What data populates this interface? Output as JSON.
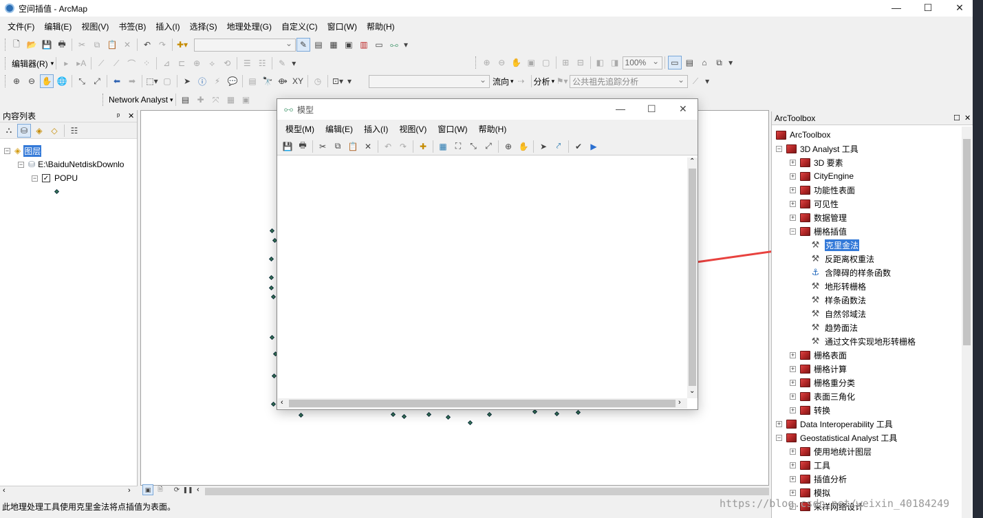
{
  "window": {
    "title": "空间插值 - ArcMap"
  },
  "menu": [
    "文件(F)",
    "编辑(E)",
    "视图(V)",
    "书签(B)",
    "插入(I)",
    "选择(S)",
    "地理处理(G)",
    "自定义(C)",
    "窗口(W)",
    "帮助(H)"
  ],
  "toolbars": {
    "editor_label": "编辑器(R)",
    "zoom_value": "100%",
    "flow_label": "流向",
    "analysis_label": "分析",
    "trace_combo": "公共祖先追踪分析",
    "network_analyst_label": "Network Analyst"
  },
  "toc": {
    "title": "内容列表",
    "pin": "ᵖ",
    "close": "✕",
    "layers_root": "图层",
    "data_source": "E:\\BaiduNetdiskDownlo",
    "layer": "POPU"
  },
  "model_window": {
    "title": "模型",
    "menu": [
      "模型(M)",
      "编辑(E)",
      "插入(I)",
      "视图(V)",
      "窗口(W)",
      "帮助(H)"
    ]
  },
  "toolbox": {
    "title": "ArcToolbox",
    "root": "ArcToolbox",
    "items": [
      {
        "label": "3D Analyst 工具",
        "level": 1,
        "expander": "⊟",
        "icon": "box"
      },
      {
        "label": "3D 要素",
        "level": 2,
        "expander": "⊞",
        "icon": "box"
      },
      {
        "label": "CityEngine",
        "level": 2,
        "expander": "⊞",
        "icon": "box"
      },
      {
        "label": "功能性表面",
        "level": 2,
        "expander": "⊞",
        "icon": "box"
      },
      {
        "label": "可见性",
        "level": 2,
        "expander": "⊞",
        "icon": "box"
      },
      {
        "label": "数据管理",
        "level": 2,
        "expander": "⊞",
        "icon": "box"
      },
      {
        "label": "栅格插值",
        "level": 2,
        "expander": "⊟",
        "icon": "box"
      },
      {
        "label": "克里金法",
        "level": 3,
        "expander": "",
        "icon": "hammer",
        "selected": true
      },
      {
        "label": "反距离权重法",
        "level": 3,
        "expander": "",
        "icon": "hammer"
      },
      {
        "label": "含障碍的样条函数",
        "level": 3,
        "expander": "",
        "icon": "script"
      },
      {
        "label": "地形转栅格",
        "level": 3,
        "expander": "",
        "icon": "hammer"
      },
      {
        "label": "样条函数法",
        "level": 3,
        "expander": "",
        "icon": "hammer"
      },
      {
        "label": "自然邻域法",
        "level": 3,
        "expander": "",
        "icon": "hammer"
      },
      {
        "label": "趋势面法",
        "level": 3,
        "expander": "",
        "icon": "hammer"
      },
      {
        "label": "通过文件实现地形转栅格",
        "level": 3,
        "expander": "",
        "icon": "hammer"
      },
      {
        "label": "栅格表面",
        "level": 2,
        "expander": "⊞",
        "icon": "box"
      },
      {
        "label": "栅格计算",
        "level": 2,
        "expander": "⊞",
        "icon": "box"
      },
      {
        "label": "栅格重分类",
        "level": 2,
        "expander": "⊞",
        "icon": "box"
      },
      {
        "label": "表面三角化",
        "level": 2,
        "expander": "⊞",
        "icon": "box"
      },
      {
        "label": "转换",
        "level": 2,
        "expander": "⊞",
        "icon": "box"
      },
      {
        "label": "Data Interoperability 工具",
        "level": 1,
        "expander": "⊞",
        "icon": "box"
      },
      {
        "label": "Geostatistical Analyst 工具",
        "level": 1,
        "expander": "⊟",
        "icon": "box"
      },
      {
        "label": "使用地统计图层",
        "level": 2,
        "expander": "⊞",
        "icon": "box"
      },
      {
        "label": "工具",
        "level": 2,
        "expander": "⊞",
        "icon": "box"
      },
      {
        "label": "插值分析",
        "level": 2,
        "expander": "⊞",
        "icon": "box"
      },
      {
        "label": "模拟",
        "level": 2,
        "expander": "⊞",
        "icon": "box"
      },
      {
        "label": "采样网络设计",
        "level": 2,
        "expander": "⊞",
        "icon": "box"
      }
    ]
  },
  "status": {
    "text": "此地理处理工具使用克里金法将点插值为表面。"
  },
  "watermark": "https://blog.csdn.net/weixin_40184249",
  "colors": {
    "accent": "#3379d8",
    "arrow": "#e8423f",
    "points": "#3a7a56"
  }
}
